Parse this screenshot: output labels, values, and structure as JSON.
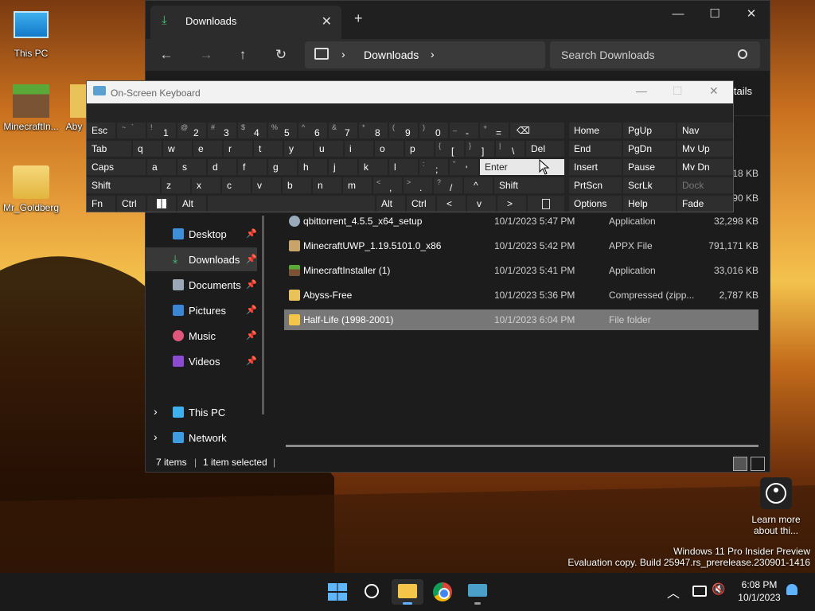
{
  "desktop": {
    "icons": [
      {
        "label": "This PC"
      },
      {
        "label": "MinecraftIn..."
      },
      {
        "label": "Aby"
      },
      {
        "label": "Mr_Goldberg"
      }
    ],
    "learn_more": "Learn more about thi...",
    "watermark": {
      "line1": "Windows 11 Pro Insider Preview",
      "line2": "Evaluation copy. Build 25947.rs_prerelease.230901-1416"
    }
  },
  "explorer": {
    "tab_title": "Downloads",
    "address": "Downloads",
    "search_placeholder": "Search Downloads",
    "details_label": "tails",
    "sidebar": [
      {
        "label": "Desktop",
        "pinned": true
      },
      {
        "label": "Downloads",
        "pinned": true,
        "selected": true
      },
      {
        "label": "Documents",
        "pinned": true
      },
      {
        "label": "Pictures",
        "pinned": true
      },
      {
        "label": "Music",
        "pinned": true
      },
      {
        "label": "Videos",
        "pinned": true
      },
      {
        "label": "This PC",
        "pinned": false
      },
      {
        "label": "Network",
        "pinned": false
      }
    ],
    "partial_sizes": [
      "18 KB",
      "90 KB"
    ],
    "files": [
      {
        "name": "qbittorrent_4.5.5_x64_setup",
        "date": "10/1/2023 5:47 PM",
        "type": "Application",
        "size": "32,298 KB"
      },
      {
        "name": "MinecraftUWP_1.19.5101.0_x86",
        "date": "10/1/2023 5:42 PM",
        "type": "APPX File",
        "size": "791,171 KB"
      },
      {
        "name": "MinecraftInstaller (1)",
        "date": "10/1/2023 5:41 PM",
        "type": "Application",
        "size": "33,016 KB"
      },
      {
        "name": "Abyss-Free",
        "date": "10/1/2023 5:36 PM",
        "type": "Compressed (zipp...",
        "size": "2,787 KB"
      },
      {
        "name": "Half-Life (1998-2001)",
        "date": "10/1/2023 6:04 PM",
        "type": "File folder",
        "size": "",
        "selected": true
      }
    ],
    "status": {
      "items": "7 items",
      "selected": "1 item selected"
    }
  },
  "osk": {
    "title": "On-Screen Keyboard",
    "row1": {
      "esc": "Esc",
      "tilde_s": "~",
      "tilde_m": "`",
      "k1": "1",
      "k1s": "!",
      "k2": "2",
      "k2s": "@",
      "k3": "3",
      "k3s": "#",
      "k4": "4",
      "k4s": "$",
      "k5": "5",
      "k5s": "%",
      "k6": "6",
      "k6s": "^",
      "k7": "7",
      "k7s": "&",
      "k8": "8",
      "k8s": "*",
      "k9": "9",
      "k9s": "(",
      "k0": "0",
      "k0s": ")",
      "minus": "-",
      "minus_s": "_",
      "eq": "=",
      "eq_s": "+",
      "bksp": "⌫"
    },
    "row2": {
      "tab": "Tab",
      "q": "q",
      "w": "w",
      "e": "e",
      "r": "r",
      "t": "t",
      "y": "y",
      "u": "u",
      "i": "i",
      "o": "o",
      "p": "p",
      "lb": "[",
      "lb_s": "{",
      "rb": "]",
      "rb_s": "}",
      "bs": "\\",
      "bs_s": "|",
      "del": "Del"
    },
    "row3": {
      "caps": "Caps",
      "a": "a",
      "s": "s",
      "d": "d",
      "f": "f",
      "g": "g",
      "h": "h",
      "j": "j",
      "k": "k",
      "l": "l",
      "semi": ";",
      "semi_s": ":",
      "quote": "'",
      "quote_s": "\"",
      "enter": "Enter"
    },
    "row4": {
      "shift": "Shift",
      "z": "z",
      "x": "x",
      "c": "c",
      "v": "v",
      "b": "b",
      "n": "n",
      "m": "m",
      "comma": ",",
      "comma_s": "<",
      "dot": ".",
      "dot_s": ">",
      "slash": "/",
      "slash_s": "?",
      "up": "^",
      "rshift": "Shift"
    },
    "row5": {
      "fn": "Fn",
      "ctrl": "Ctrl",
      "alt": "Alt",
      "ralt": "Alt",
      "rctrl": "Ctrl",
      "left": "<",
      "down": "v",
      "right": ">"
    },
    "nav": {
      "home": "Home",
      "pgup": "PgUp",
      "nav": "Nav",
      "end": "End",
      "pgdn": "PgDn",
      "mvup": "Mv Up",
      "insert": "Insert",
      "pause": "Pause",
      "mvdn": "Mv Dn",
      "prtscn": "PrtScn",
      "scrlk": "ScrLk",
      "dock": "Dock",
      "options": "Options",
      "help": "Help",
      "fade": "Fade"
    }
  },
  "taskbar": {
    "time": "6:08 PM",
    "date": "10/1/2023"
  }
}
